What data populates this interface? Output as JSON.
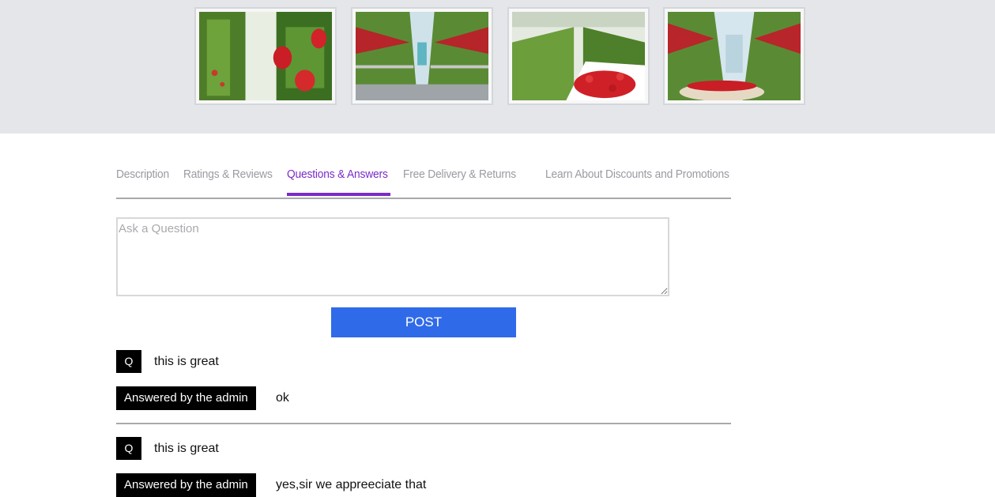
{
  "gallery": {
    "images": [
      {
        "alt": "strawberry-greenhouse-1"
      },
      {
        "alt": "strawberry-greenhouse-2"
      },
      {
        "alt": "strawberry-greenhouse-3"
      },
      {
        "alt": "strawberry-greenhouse-4"
      }
    ]
  },
  "tabs": [
    {
      "label": "Description",
      "active": false
    },
    {
      "label": "Ratings & Reviews",
      "active": false
    },
    {
      "label": "Questions & Answers",
      "active": true
    },
    {
      "label": "Free Delivery & Returns",
      "active": false
    },
    {
      "label": "Learn About Discounts and Promotions",
      "active": false
    }
  ],
  "question_form": {
    "placeholder": "Ask a Question",
    "value": "",
    "post_label": "POST"
  },
  "qa": [
    {
      "q_badge": "Q",
      "question": "this is great",
      "answer_badge": "Answered by the admin",
      "answer": "ok"
    },
    {
      "q_badge": "Q",
      "question": "this is great",
      "answer_badge": "Answered by the admin",
      "answer": "yes,sir we appreeciate that"
    }
  ],
  "colors": {
    "accent": "#7b2bc9",
    "button": "#2f6ae9",
    "band": "#e4e6ea"
  }
}
